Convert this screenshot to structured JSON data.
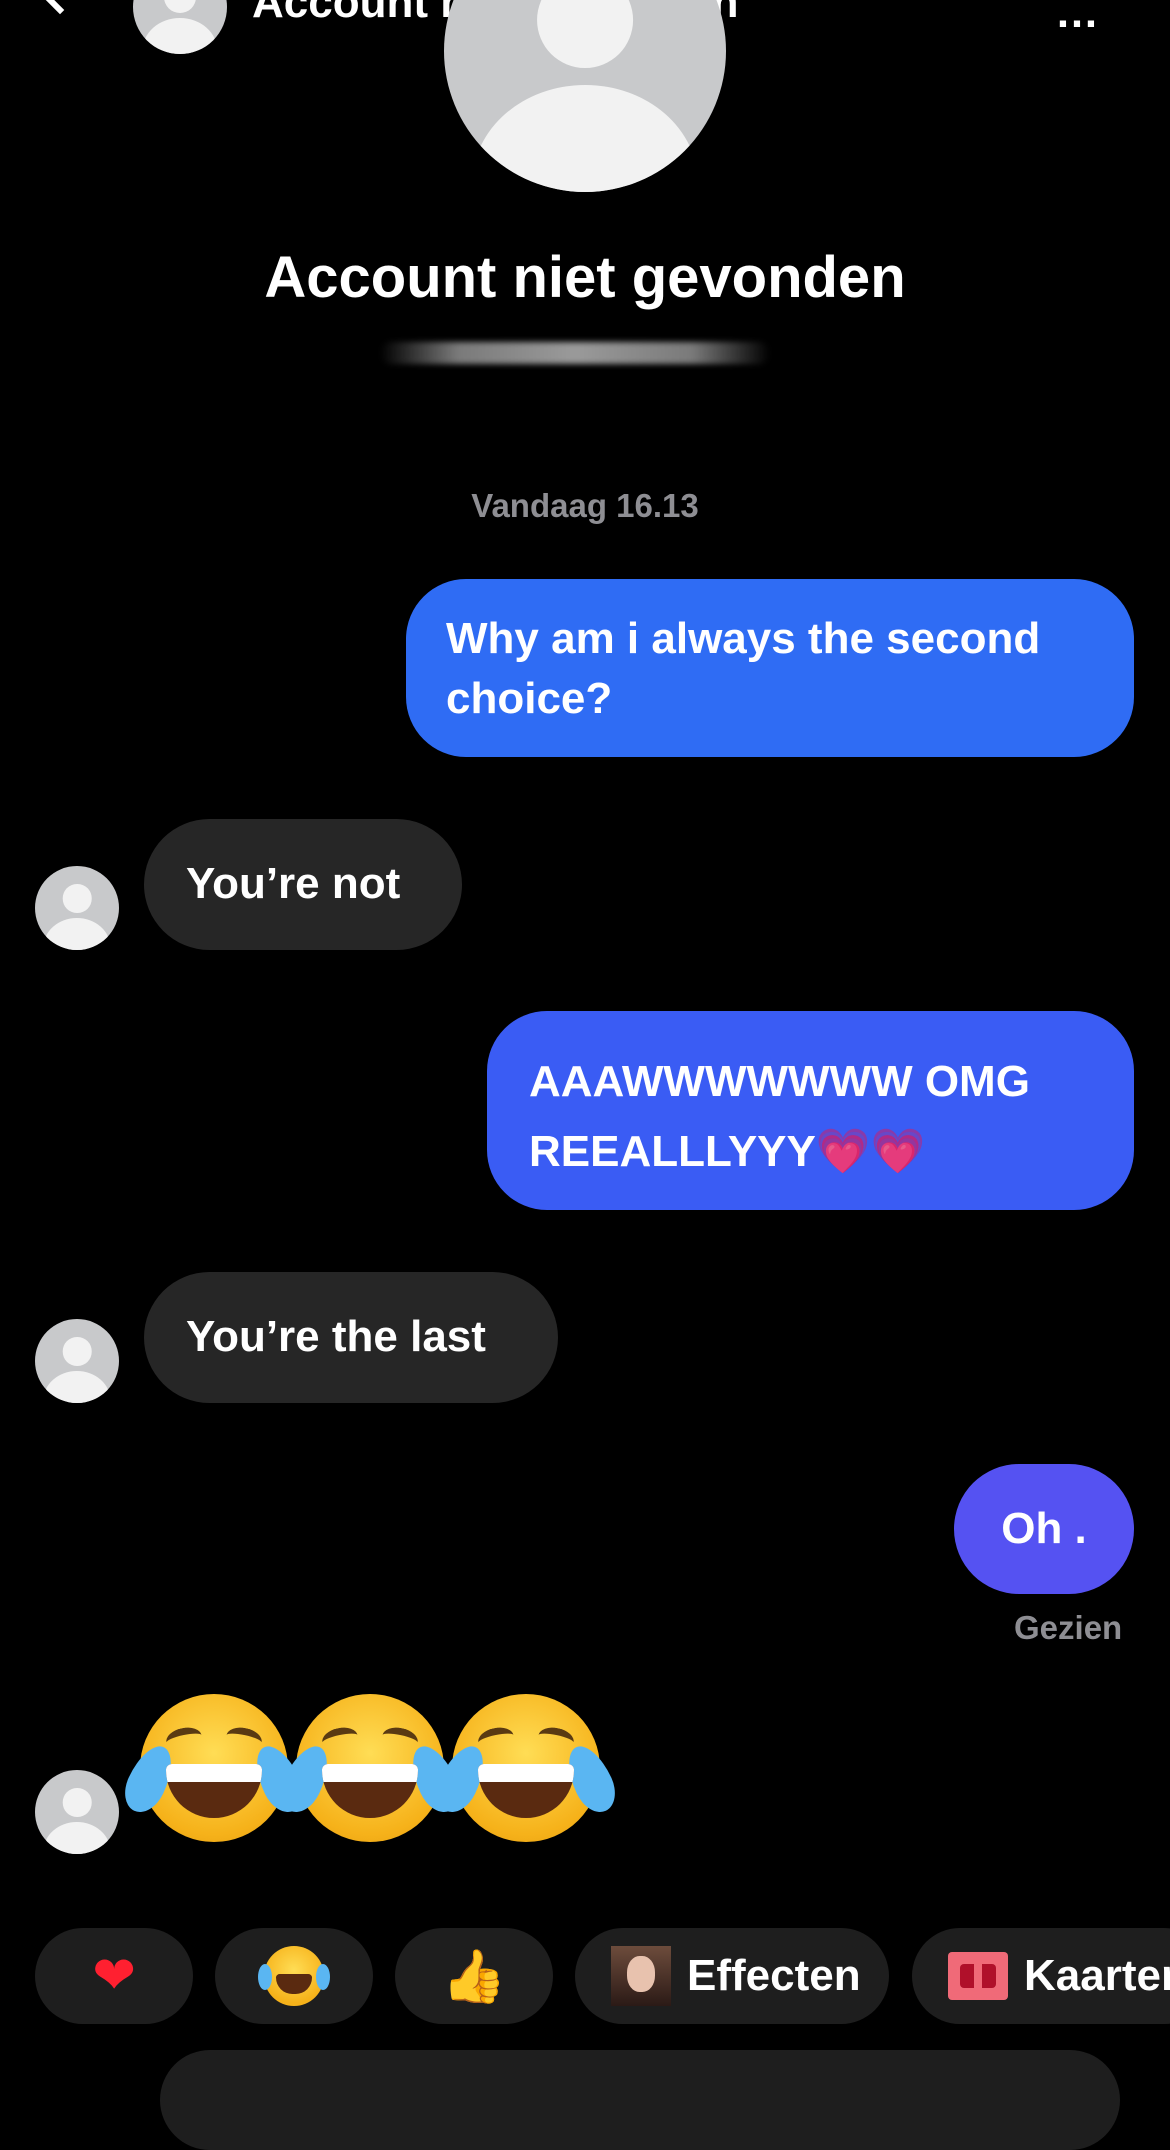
{
  "header": {
    "title": "Account niet gevonden",
    "more": "…"
  },
  "profile": {
    "name": "Account niet gevonden"
  },
  "conversation": {
    "timestamp": "Vandaag 16.13",
    "messages": [
      {
        "from": "me",
        "text": "Why am i always the second choice?"
      },
      {
        "from": "them",
        "text": "You’re not"
      },
      {
        "from": "me",
        "text": "AAAWWWWWWW OMG REEALLLYYY💗💗"
      },
      {
        "from": "them",
        "text": "You’re the last"
      },
      {
        "from": "me",
        "text": "Oh ."
      },
      {
        "from": "them",
        "text": "😂😂😂"
      }
    ],
    "seen_label": "Gezien"
  },
  "quick_replies": {
    "heart": "❤️",
    "laugh": "😂",
    "thumbs_up": "👍",
    "effects_label": "Effecten",
    "cards_label": "Kaarten"
  },
  "colors": {
    "background": "#000000",
    "outgoing_bubble_1": "#2f6cf4",
    "outgoing_bubble_2": "#3a5cf4",
    "outgoing_bubble_3": "#5552f2",
    "incoming_bubble": "#262626",
    "muted_text": "#8e8e93"
  }
}
